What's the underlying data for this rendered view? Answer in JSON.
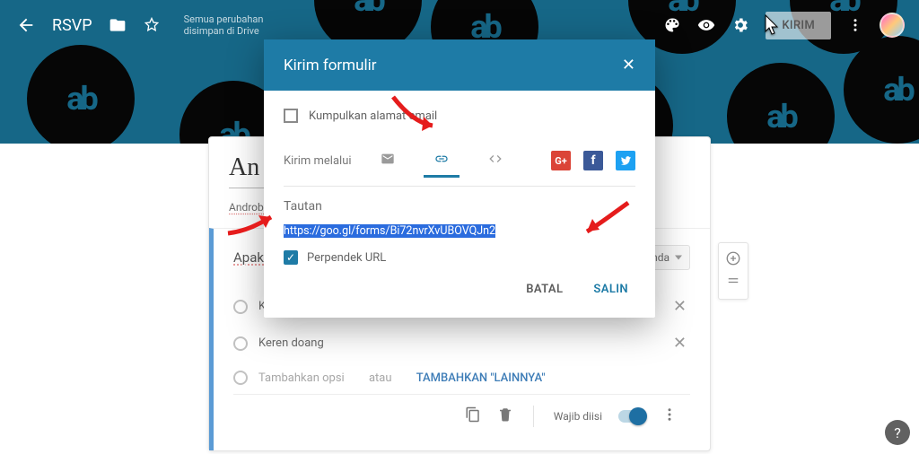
{
  "header": {
    "title": "RSVP",
    "save_status": "Semua perubahan disimpan di Drive"
  },
  "toolbar": {
    "send_label": "KIRIM"
  },
  "form": {
    "title_visible": "An",
    "description_visible": "Androbu",
    "question": {
      "text": "Apakah Androbuntu Keren?",
      "type_label": "Pilihan ganda",
      "options": [
        "Keren banget",
        "Keren doang"
      ],
      "add_option_text": "Tambahkan opsi",
      "add_other_sep": "atau",
      "add_other_label": "TAMBAHKAN \"LAINNYA\""
    },
    "footer": {
      "required_label": "Wajib diisi"
    }
  },
  "modal": {
    "title": "Kirim formulir",
    "collect_label": "Kumpulkan alamat email",
    "send_via_label": "Kirim melalui",
    "link_section_title": "Tautan",
    "url": "https://goo.gl/forms/Bi72nvrXvUBOVQJn2",
    "shorten_label": "Perpendek URL",
    "cancel_label": "BATAL",
    "copy_label": "SALIN"
  }
}
